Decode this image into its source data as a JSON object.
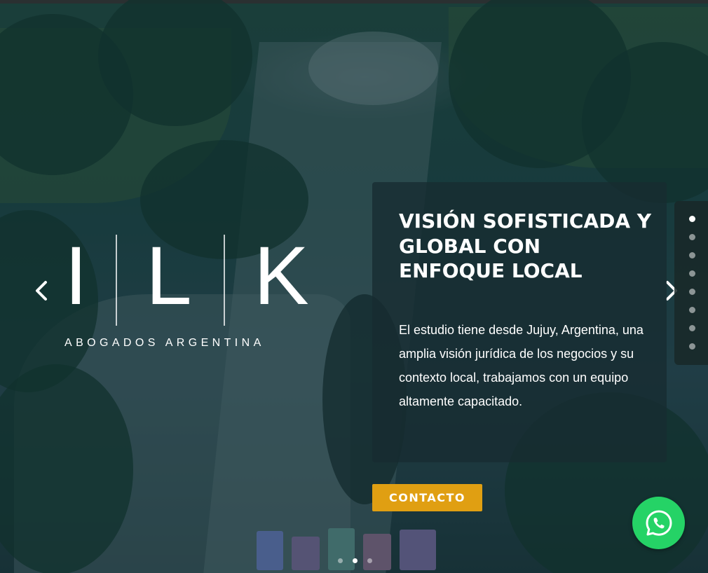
{
  "slider": {
    "logo": {
      "letters": [
        "I",
        "L",
        "K"
      ],
      "subtitle": "ABOGADOS ARGENTINA"
    },
    "caption": {
      "title": "VISIÓN SOFISTICADA Y GLOBAL CON ENFOQUE LOCAL",
      "text": "El estudio tiene desde Jujuy, Argentina, una amplia visión jurídica de los negocios y su contexto local, trabajamos con un equipo altamente capacitado."
    },
    "contact_button": "CONTACTO",
    "prev_icon": "chevron-left-icon",
    "next_icon": "chevron-right-icon",
    "side_dots_count": 8,
    "side_active_index": 0,
    "bottom_dots_count": 3,
    "bottom_active_index": 1
  },
  "whatsapp": {
    "icon": "whatsapp-icon",
    "color": "#25d366"
  },
  "colors": {
    "accent": "#e09f12",
    "overlay": "#172b31"
  }
}
